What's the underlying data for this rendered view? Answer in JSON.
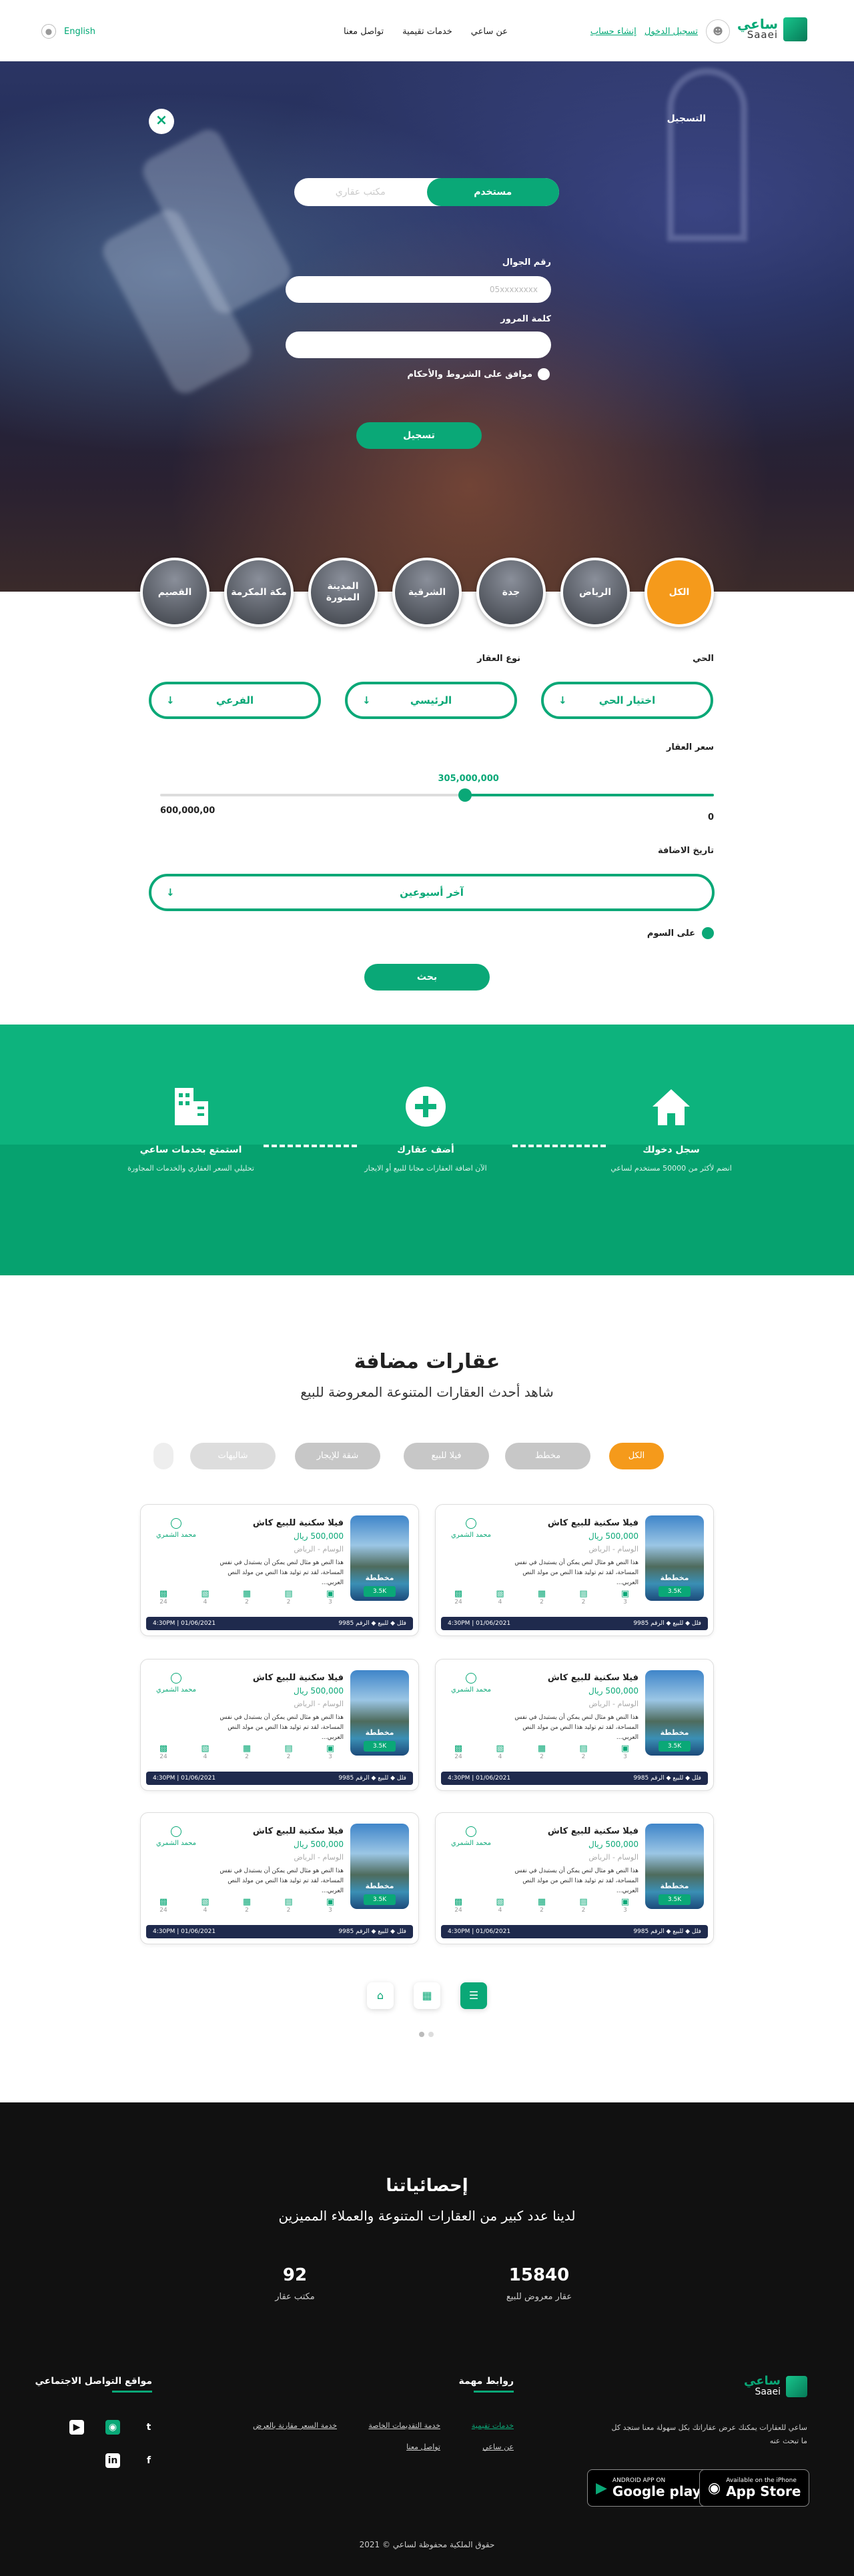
{
  "header": {
    "logo_ar": "ساعي",
    "logo_en": "Saaei",
    "user_icon": "user-icon",
    "login_link": "تسجيل الدخول",
    "register_link": "إنشاء حساب",
    "nav": [
      "عن ساعي",
      "خدمات تقيمية",
      "تواصل معنا"
    ],
    "language": "English"
  },
  "register": {
    "title": "التسجيل",
    "close": "×",
    "type_user": "مستخدم",
    "type_office": "مكتب عقاري",
    "phone_label": "رقم الجوال",
    "phone_placeholder": "05xxxxxxxx",
    "password_label": "كلمة المرور",
    "password_placeholder": "",
    "agree_label": "موافق على الشروط والأحكام",
    "submit": "تسجيل"
  },
  "cities": [
    "الكل",
    "الرياض",
    "جدة",
    "الشرقية",
    "المدينة المنورة",
    "مكة المكرمة",
    "القصيم"
  ],
  "search": {
    "district_label": "الحي",
    "type_label": "نوع العقار",
    "district_value": "اختيار الحي",
    "main_type": "الرئيسي",
    "sub_type": "الفرعي",
    "price_label": "سعر العقار",
    "price_min": "0",
    "price_max": "600,000,00",
    "price_current": "305,000,000",
    "price_fraction": 0.45,
    "date_label": "تاريخ الاضافة",
    "date_value": "آخر أسبوعين",
    "map_label": "على السوم",
    "search_button": "بحث"
  },
  "services": [
    {
      "icon": "house-icon",
      "title": "سجل دخولك",
      "desc": "انضم لأكثر من 50000 مستخدم لساعي"
    },
    {
      "icon": "plus-icon",
      "title": "أضف عقارك",
      "desc": "الآن اضافة العقارات مجانا للبيع أو الايجار"
    },
    {
      "icon": "building-icon",
      "title": "استمتع بخدمات ساعي",
      "desc": "تحليلي السعر العقاري والخدمات المجاورة"
    }
  ],
  "properties": {
    "title": "عقارات مضافة",
    "subtitle": "شاهد أحدث العقارات المتنوعة المعروضة للبيع",
    "filters": [
      "الكل",
      "مخطط",
      "فيلا للبيع",
      "شقة للإيجار",
      "شاليهات"
    ],
    "card": {
      "name": "فيلا سكنية للبيع كاش",
      "price": "500,000 ريال",
      "location": "الوسام - الرياض",
      "desc": "هذا النص هو مثال لنص يمكن أن يستبدل في نفس المساحة، لقد تم توليد هذا النص من مولد النص العربي...",
      "badge": "مخططة",
      "size": "3.5K",
      "owner": "محمد الشمري",
      "amenities": [
        "3",
        "2",
        "2",
        "4",
        "24"
      ],
      "bar_type": "فلل",
      "bar_sale": "للبيع",
      "bar_number_label": "الرقم",
      "bar_number": "9985",
      "bar_date": "01/06/2021 | 4:30PM"
    },
    "pagination": [
      "home-icon",
      "map-icon",
      "list-icon"
    ]
  },
  "stats": {
    "title": "إحصائياتنا",
    "subtitle": "لدينا عدد كبير من العقارات المتنوعة والعملاء المميزين",
    "items": [
      {
        "number": "15840",
        "label": "عقار معروض للبيع"
      },
      {
        "number": "92",
        "label": "مكتب عقار"
      }
    ]
  },
  "footer": {
    "about": "ساعي للعقارات يمكنك عرض عقاراتك بكل سهولة معنا ستجد كل ما تبحث عنه",
    "links_title": "روابط مهمة",
    "links": [
      "خدمات تقيمية",
      "عن ساعي",
      "خدمة التقديمات الخاصة",
      "تواصل معنا",
      "خدمة السعر مقارنة بالعرض"
    ],
    "social_title": "مواقع التواصل الاجتماعي",
    "app_store_small": "Available on the iPhone",
    "app_store": "App Store",
    "google_small": "ANDROID APP ON",
    "google": "Google play",
    "copyright": "حقوق الملكية محفوظة لساعي © 2021"
  },
  "colors": {
    "primary": "#0aa877",
    "accent": "#f59a1b",
    "dark": "#111111"
  }
}
